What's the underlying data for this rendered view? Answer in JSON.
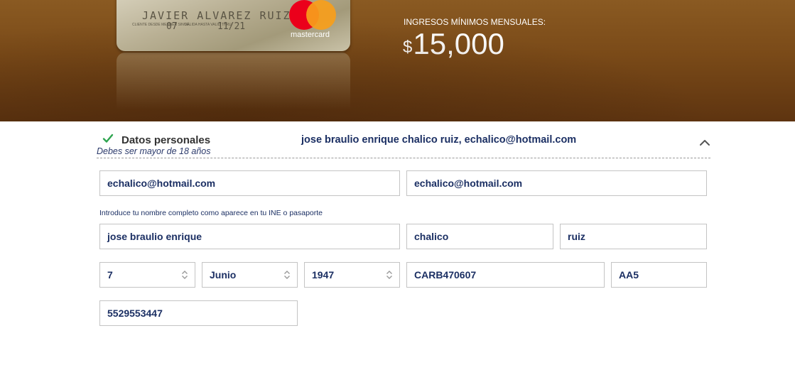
{
  "card": {
    "name": "JAVIER ALVAREZ RUIZ",
    "member_since_label": "CLIENTE DESDE MEMBER SINCE",
    "member_since_value": "07",
    "valid_thru_label": "VÁLIDA HASTA VALID THRU",
    "valid_thru_value": "11/21",
    "brand": "mastercard"
  },
  "income": {
    "label": "INGRESOS MÍNIMOS MENSUALES:",
    "currency": "$",
    "amount": "15,000"
  },
  "section": {
    "title": "Datos personales",
    "subtitle": "Debes ser mayor de 18 años",
    "summary": "jose braulio enrique chalico ruiz, echalico@hotmail.com",
    "status_color": "#2ea44f"
  },
  "form": {
    "email": "echalico@hotmail.com",
    "email_confirm": "echalico@hotmail.com",
    "name_hint": "Introduce tu nombre completo como aparece en tu INE o pasaporte",
    "first_name": "jose braulio enrique",
    "last_name_1": "chalico",
    "last_name_2": "ruiz",
    "birth_day": "7",
    "birth_month": "Junio",
    "birth_year": "1947",
    "rfc": "CARB470607",
    "homoclave": "AA5",
    "phone": "5529553447"
  },
  "icons": {
    "check": "check-icon",
    "chevron": "chevron-up-icon",
    "spinner": "select-spinner-icon"
  }
}
